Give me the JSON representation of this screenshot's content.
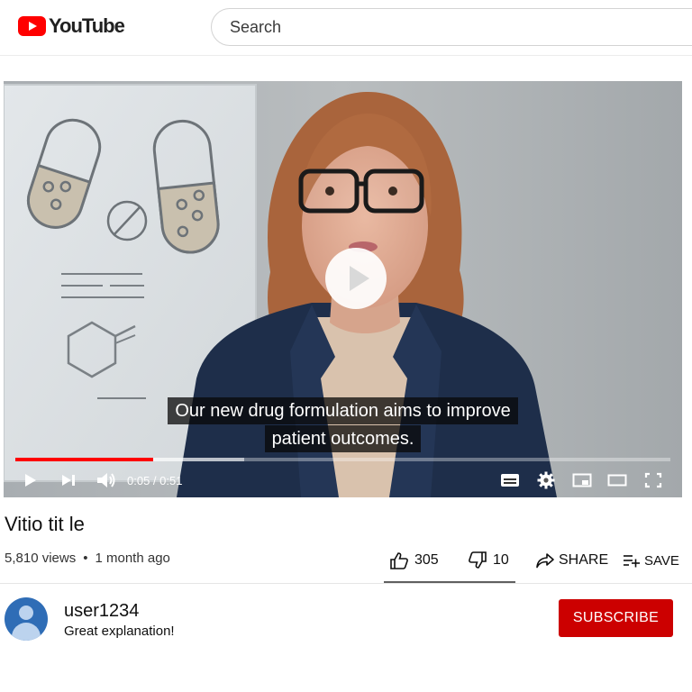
{
  "header": {
    "logo_text": "YouTube",
    "search_placeholder": "Search"
  },
  "player": {
    "caption_line1": "Our new drug formulation aims to improve",
    "caption_line2": "patient outcomes.",
    "time_display": "0:05 / 0:51",
    "progress_fraction": 0.21,
    "accent_color": "#ff0000"
  },
  "video": {
    "title": "Vitio tit le",
    "views": "5,810 views",
    "age": "1 month ago",
    "like_count": "305",
    "dislike_count": "10",
    "share_label": "SHARE",
    "save_label": "SAVE"
  },
  "comment": {
    "username": "user1234",
    "text": "Great explanation!"
  },
  "subscribe_label": "SUBSCRIBE",
  "subscribe_color": "#cc0000"
}
